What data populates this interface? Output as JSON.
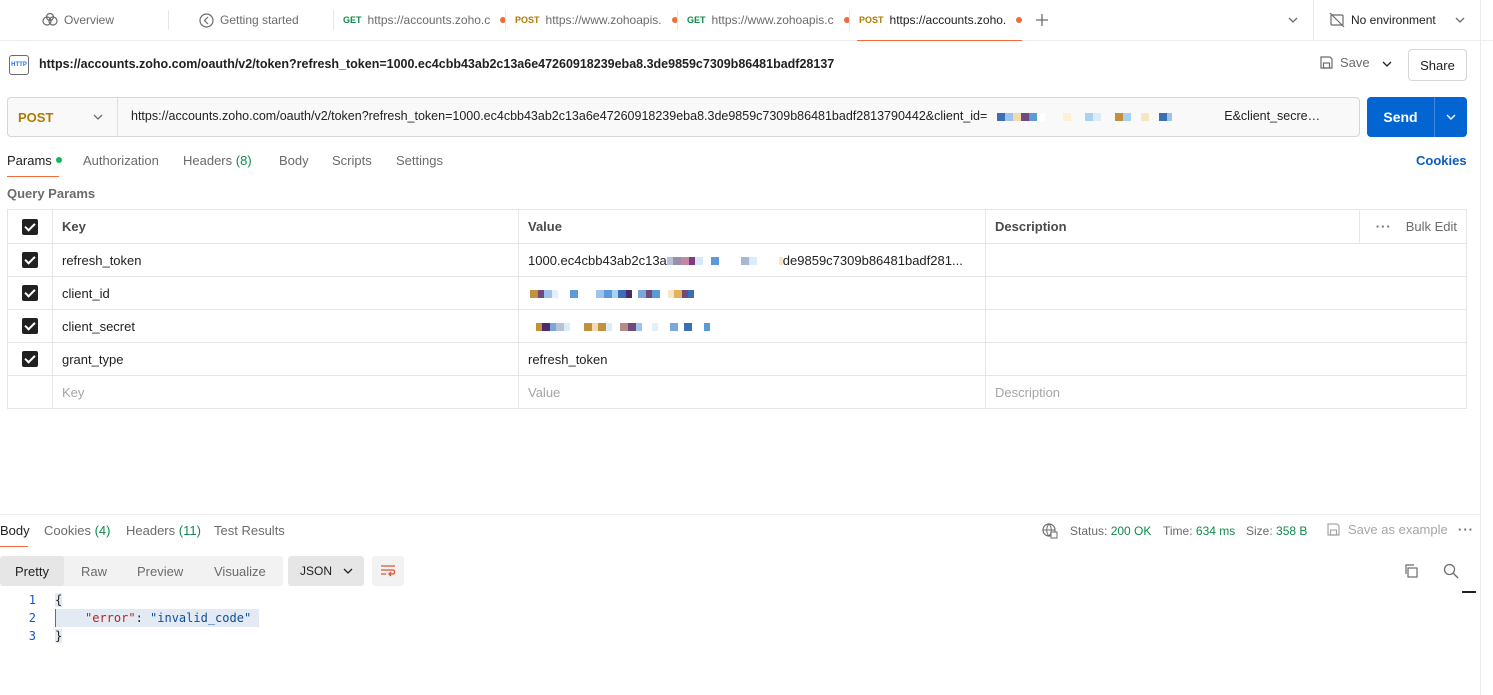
{
  "tabs": [
    {
      "icon": "overview-icon",
      "label": "Overview"
    },
    {
      "icon": "getting-started-icon",
      "label": "Getting started"
    },
    {
      "method": "GET",
      "label": "https://accounts.zoho.c"
    },
    {
      "method": "POST",
      "label": "https://www.zohoapis."
    },
    {
      "method": "GET",
      "label": "https://www.zohoapis.c"
    },
    {
      "method": "POST",
      "label": "https://accounts.zoho."
    }
  ],
  "environment": {
    "label": "No environment"
  },
  "request": {
    "title": "https://accounts.zoho.com/oauth/v2/token?refresh_token=1000.ec4cbb43ab2c13a6e47260918239eba8.3de9859c7309b86481badf28137",
    "http_badge": "HTTP",
    "save_label": "Save",
    "share_label": "Share",
    "method": "POST",
    "url_start": "https://accounts.zoho.com/oauth/v2/token?refresh_token=1000.ec4cbb43ab2c13a6e47260918239eba8.3de9859c7309b86481badf2813790442&client_id=",
    "url_end": "E&client_secre…",
    "send_label": "Send"
  },
  "request_tabs": {
    "params": "Params",
    "authorization": "Authorization",
    "headers": "Headers",
    "headers_count": "(8)",
    "body": "Body",
    "scripts": "Scripts",
    "settings": "Settings",
    "cookies": "Cookies"
  },
  "query_params": {
    "heading": "Query Params",
    "columns": {
      "key": "Key",
      "value": "Value",
      "description": "Description",
      "bulk_edit": "Bulk Edit"
    },
    "rows": [
      {
        "key": "refresh_token",
        "value_start": "1000.ec4cbb43ab2c13a",
        "value_end": "de9859c7309b86481badf281..."
      },
      {
        "key": "client_id",
        "value_start": "",
        "value_end": ""
      },
      {
        "key": "client_secret",
        "value_start": "",
        "value_end": ""
      },
      {
        "key": "grant_type",
        "value_start": "refresh_token",
        "value_end": ""
      }
    ],
    "placeholder": {
      "key": "Key",
      "value": "Value",
      "description": "Description"
    }
  },
  "response": {
    "tabs": {
      "body": "Body",
      "cookies": "Cookies",
      "cookies_count": "(4)",
      "headers": "Headers",
      "headers_count": "(11)",
      "test_results": "Test Results"
    },
    "status_label": "Status:",
    "status_value": "200 OK",
    "time_label": "Time:",
    "time_value": "634 ms",
    "size_label": "Size:",
    "size_value": "358 B",
    "save_example": "Save as example",
    "views": {
      "pretty": "Pretty",
      "raw": "Raw",
      "preview": "Preview",
      "visualize": "Visualize"
    },
    "format": "JSON",
    "lines": [
      {
        "num": "1",
        "text": "{"
      },
      {
        "num": "2",
        "key": "\"error\"",
        "sep": ": ",
        "value": "\"invalid_code\""
      },
      {
        "num": "3",
        "text": "}"
      }
    ]
  }
}
